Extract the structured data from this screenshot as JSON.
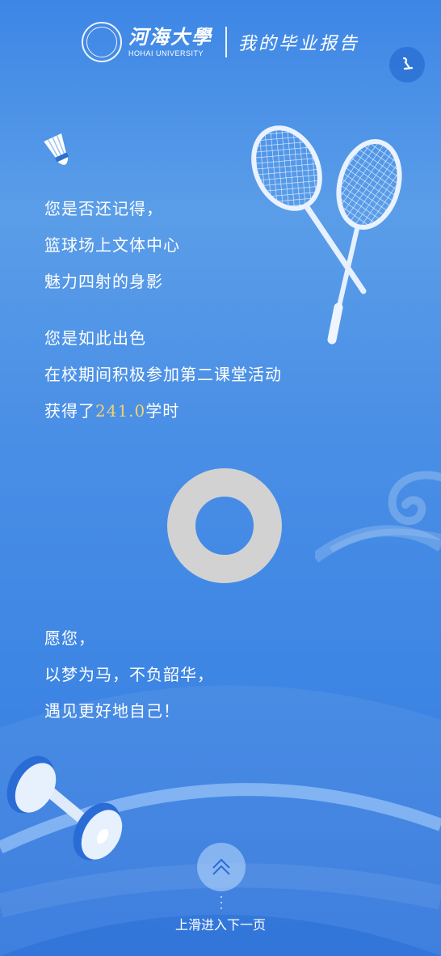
{
  "header": {
    "logo_cn": "河海大學",
    "logo_en": "HOHAI UNIVERSITY",
    "title": "我的毕业报告"
  },
  "music_button": {
    "icon": "music-note-icon"
  },
  "message": {
    "line1": "您是否还记得，",
    "line2": "篮球场上文体中心",
    "line3": "魅力四射的身影",
    "line4": "您是如此出色",
    "line5": "在校期间积极参加第二课堂活动",
    "line6_prefix": "获得了",
    "hours_value": "241.0",
    "line6_suffix": "学时"
  },
  "wish": {
    "line1": "愿您，",
    "line2": "以梦为马，不负韶华，",
    "line3": "遇见更好地自己！"
  },
  "footer": {
    "swipe_label": "上滑进入下一页",
    "swipe_icon": "double-chevron-up-icon"
  },
  "colors": {
    "highlight": "#f2d36b",
    "donut": "#d2d2d2",
    "background_top": "#3d86e6",
    "background_bottom": "#3478dd"
  }
}
